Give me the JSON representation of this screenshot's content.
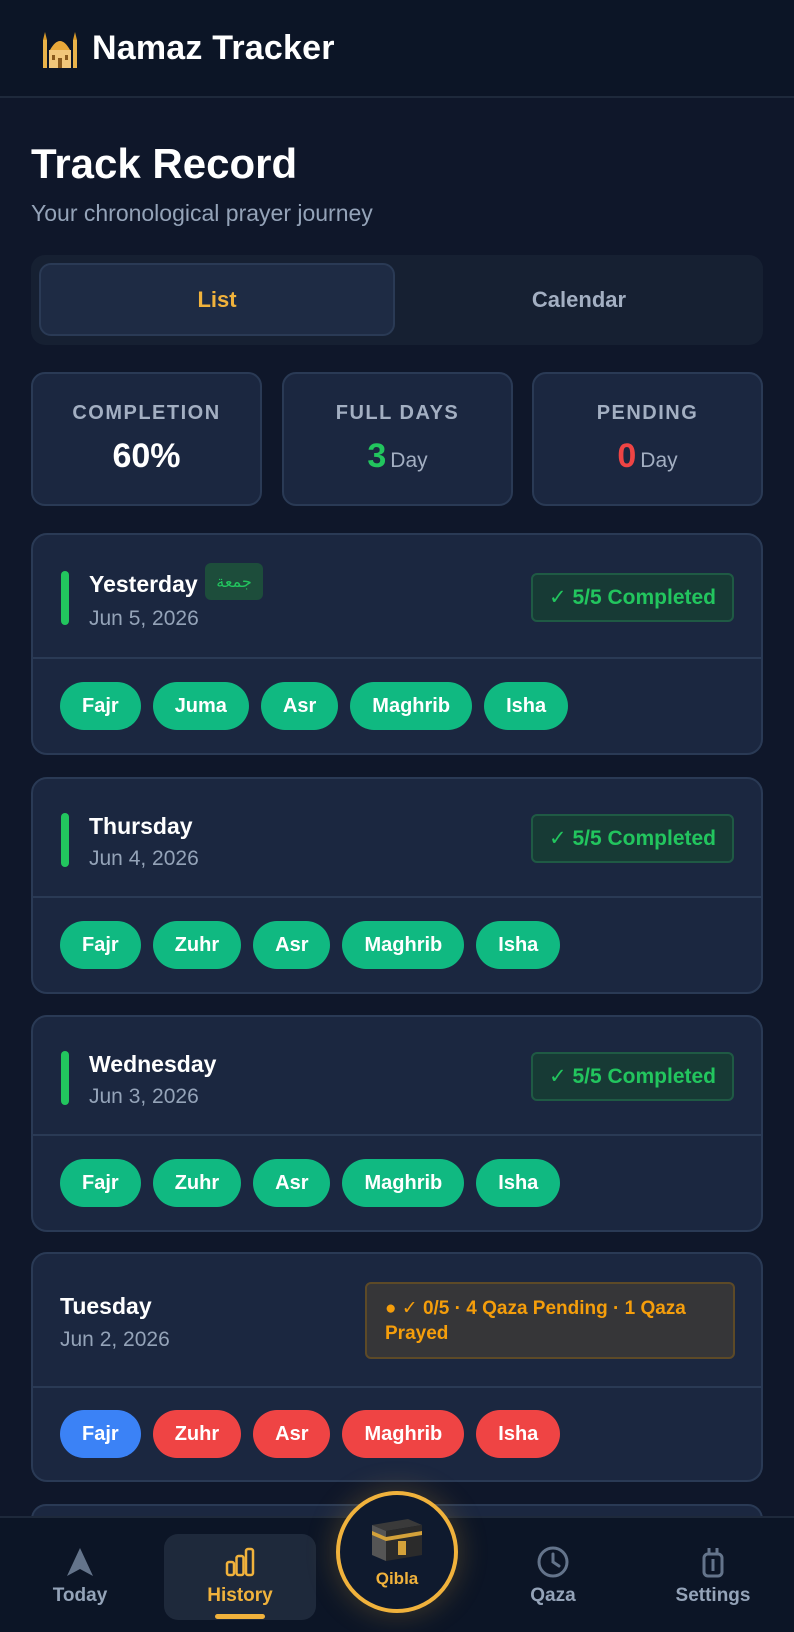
{
  "app": {
    "title": "Namaz Tracker",
    "icon": "mosque-icon"
  },
  "page": {
    "title": "Track Record",
    "subtitle": "Your chronological prayer journey"
  },
  "view_toggle": {
    "options": [
      "List",
      "Calendar"
    ],
    "selected": "List"
  },
  "stats": [
    {
      "label": "COMPLETION",
      "value": "60%",
      "unit": ""
    },
    {
      "label": "FULL DAYS",
      "value": "3",
      "unit": "Day"
    },
    {
      "label": "PENDING",
      "value": "0",
      "unit": "Day"
    }
  ],
  "days": [
    {
      "name": "Yesterday",
      "tag": "جمعة",
      "date": "Jun 5, 2026",
      "status": "✓ 5/5 Completed",
      "status_type": "complete",
      "prayers": [
        {
          "name": "Fajr",
          "state": "prayed"
        },
        {
          "name": "Juma",
          "state": "prayed"
        },
        {
          "name": "Asr",
          "state": "prayed"
        },
        {
          "name": "Maghrib",
          "state": "prayed"
        },
        {
          "name": "Isha",
          "state": "prayed"
        }
      ]
    },
    {
      "name": "Thursday",
      "date": "Jun 4, 2026",
      "status": "✓ 5/5 Completed",
      "status_type": "complete",
      "prayers": [
        {
          "name": "Fajr",
          "state": "prayed"
        },
        {
          "name": "Zuhr",
          "state": "prayed"
        },
        {
          "name": "Asr",
          "state": "prayed"
        },
        {
          "name": "Maghrib",
          "state": "prayed"
        },
        {
          "name": "Isha",
          "state": "prayed"
        }
      ]
    },
    {
      "name": "Wednesday",
      "date": "Jun 3, 2026",
      "status": "✓ 5/5 Completed",
      "status_type": "complete",
      "prayers": [
        {
          "name": "Fajr",
          "state": "prayed"
        },
        {
          "name": "Zuhr",
          "state": "prayed"
        },
        {
          "name": "Asr",
          "state": "prayed"
        },
        {
          "name": "Maghrib",
          "state": "prayed"
        },
        {
          "name": "Isha",
          "state": "prayed"
        }
      ]
    },
    {
      "name": "Tuesday",
      "date": "Jun 2, 2026",
      "status": "● ✓ 0/5 · 4 Qaza Pending · 1 Qaza Prayed",
      "status_type": "warning",
      "prayers": [
        {
          "name": "Fajr",
          "state": "qaza-prayed"
        },
        {
          "name": "Zuhr",
          "state": "missed"
        },
        {
          "name": "Asr",
          "state": "missed"
        },
        {
          "name": "Maghrib",
          "state": "missed"
        },
        {
          "name": "Isha",
          "state": "missed"
        }
      ]
    }
  ],
  "nav": {
    "items": [
      "Today",
      "History",
      "Qibla",
      "Qaza",
      "Settings"
    ],
    "active": "History"
  },
  "colors": {
    "accent": "#f0b23c",
    "success": "#22c55e",
    "prayed": "#10b981",
    "missed": "#ef4444",
    "qaza": "#3b82f6",
    "warning": "#f59e0b"
  }
}
